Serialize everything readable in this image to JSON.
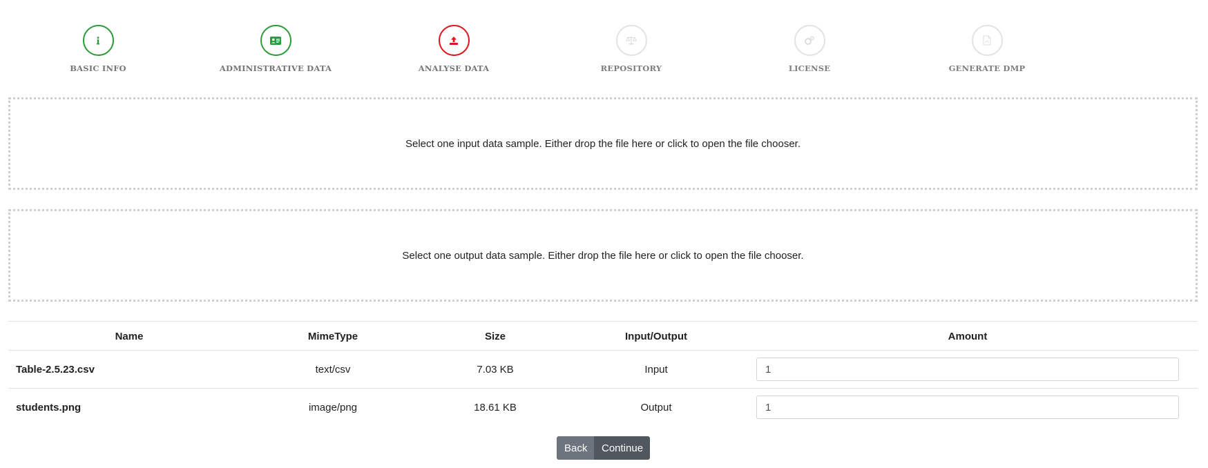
{
  "stepper": {
    "steps": [
      {
        "label": "BASIC INFO",
        "icon": "info-icon",
        "state": "done",
        "color": "#2e9b3a"
      },
      {
        "label": "ADMINISTRATIVE DATA",
        "icon": "id-card-icon",
        "state": "done",
        "color": "#2e9b3a"
      },
      {
        "label": "ANALYSE DATA",
        "icon": "upload-icon",
        "state": "active",
        "color": "#e0161e"
      },
      {
        "label": "REPOSITORY",
        "icon": "balance-scale-icon",
        "state": "pending",
        "color": "#dddddd"
      },
      {
        "label": "LICENSE",
        "icon": "cogs-icon",
        "state": "pending",
        "color": "#dddddd"
      },
      {
        "label": "GENERATE DMP",
        "icon": "file-pdf-icon",
        "state": "pending",
        "color": "#dddddd"
      }
    ]
  },
  "dropzones": {
    "input_text": "Select one input data sample. Either drop the file here or click to open the file chooser.",
    "output_text": "Select one output data sample. Either drop the file here or click to open the file chooser."
  },
  "table": {
    "headers": {
      "name": "Name",
      "mimetype": "MimeType",
      "size": "Size",
      "io": "Input/Output",
      "amount": "Amount"
    },
    "rows": [
      {
        "name": "Table-2.5.23.csv",
        "mimetype": "text/csv",
        "size": "7.03 KB",
        "io": "Input",
        "amount": "1"
      },
      {
        "name": "students.png",
        "mimetype": "image/png",
        "size": "18.61 KB",
        "io": "Output",
        "amount": "1"
      }
    ]
  },
  "buttons": {
    "back": "Back",
    "continue": "Continue"
  }
}
